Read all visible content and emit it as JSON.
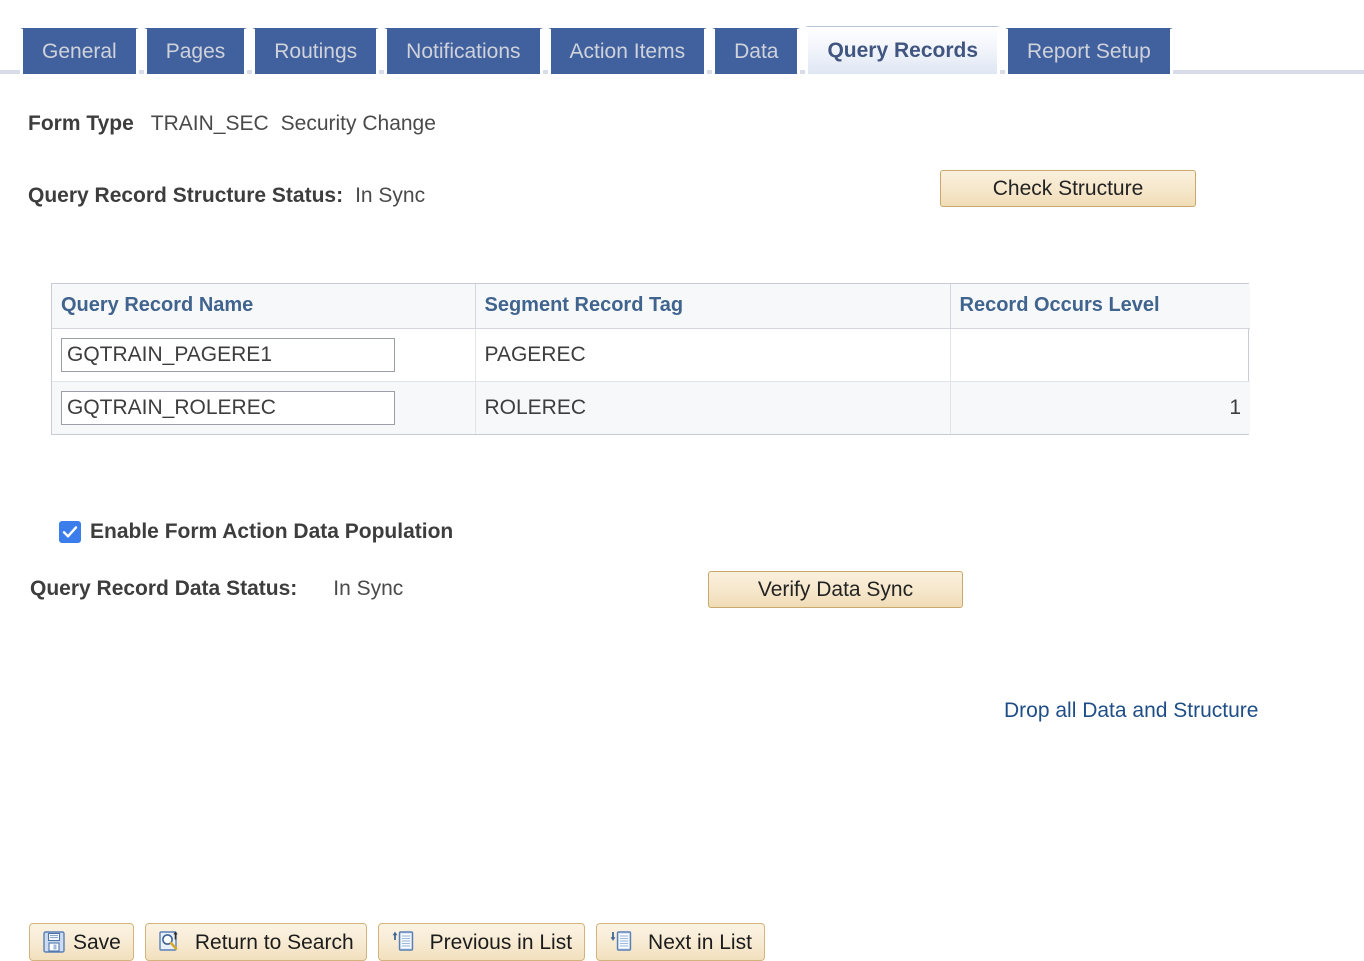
{
  "tabs": [
    {
      "label": "General",
      "active": false
    },
    {
      "label": "Pages",
      "active": false
    },
    {
      "label": "Routings",
      "active": false
    },
    {
      "label": "Notifications",
      "active": false
    },
    {
      "label": "Action Items",
      "active": false
    },
    {
      "label": "Data",
      "active": false
    },
    {
      "label": "Query Records",
      "active": true
    },
    {
      "label": "Report Setup",
      "active": false
    }
  ],
  "form_type": {
    "label": "Form Type",
    "code": "TRAIN_SEC",
    "description": "Security Change"
  },
  "structure_status": {
    "label": "Query Record Structure Status:",
    "value": "In Sync"
  },
  "check_structure_button": {
    "label": "Check Structure"
  },
  "grid": {
    "columns": [
      "Query Record Name",
      "Segment Record Tag",
      "Record Occurs Level"
    ],
    "rows": [
      {
        "query_record_name": "GQTRAIN_PAGERE1",
        "segment_record_tag": "PAGEREC",
        "record_occurs_level": ""
      },
      {
        "query_record_name": "GQTRAIN_ROLEREC",
        "segment_record_tag": "ROLEREC",
        "record_occurs_level": "1"
      }
    ]
  },
  "enable_checkbox": {
    "label": "Enable Form Action Data Population",
    "checked": true,
    "accent_color": "#3b7dea"
  },
  "data_status": {
    "label": "Query Record Data Status:",
    "value": "In Sync"
  },
  "verify_data_sync_button": {
    "label": "Verify Data Sync"
  },
  "drop_link": {
    "label": "Drop all Data and Structure",
    "color": "#1f4e87"
  },
  "toolbar": {
    "save_label": "Save",
    "return_to_search_label": "Return to Search",
    "previous_in_list_label": "Previous in List",
    "next_in_list_label": "Next in List"
  },
  "colors": {
    "tab_inactive_bg": "#41619e",
    "tab_inactive_text": "#cfd2da",
    "tab_active_text": "#40557f",
    "grid_header_text": "#41648f",
    "button_cream": "#f6e7cb",
    "button_border": "#c9a96b"
  }
}
